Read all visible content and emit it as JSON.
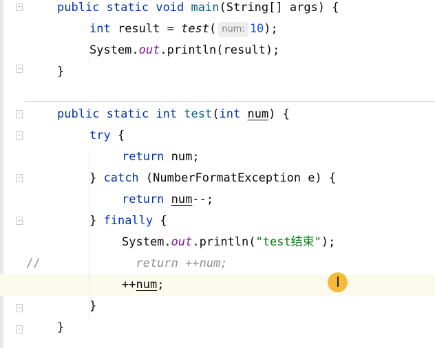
{
  "editor": {
    "lines": [
      {
        "indent": 0,
        "tokens": [
          [
            "kw",
            "public"
          ],
          [
            "t",
            " "
          ],
          [
            "kw",
            "static"
          ],
          [
            "t",
            " "
          ],
          [
            "kw",
            "void"
          ],
          [
            "t",
            " "
          ],
          [
            "fn",
            "main"
          ],
          [
            "t",
            "(String[] args) {"
          ]
        ]
      },
      {
        "indent": 1,
        "tokens": [
          [
            "kw",
            "int"
          ],
          [
            "t",
            " result = "
          ],
          [
            "ic",
            "test"
          ],
          [
            "t",
            "("
          ],
          [
            "hint",
            "num:"
          ],
          [
            "num",
            "10"
          ],
          [
            "t",
            ");"
          ]
        ]
      },
      {
        "indent": 1,
        "tokens": [
          [
            "t",
            "System."
          ],
          [
            "f",
            "out"
          ],
          [
            "t",
            ".println(result);"
          ]
        ]
      },
      {
        "indent": 0,
        "tokens": [
          [
            "t",
            "}"
          ]
        ]
      },
      {
        "indent": 0,
        "tokens": []
      },
      {
        "indent": 0,
        "tokens": [
          [
            "kw",
            "public"
          ],
          [
            "t",
            " "
          ],
          [
            "kw",
            "static"
          ],
          [
            "t",
            " "
          ],
          [
            "kw",
            "int"
          ],
          [
            "t",
            " "
          ],
          [
            "fn",
            "test"
          ],
          [
            "t",
            "("
          ],
          [
            "kw",
            "int"
          ],
          [
            "t",
            " "
          ],
          [
            "u",
            "num"
          ],
          [
            "t",
            ") {"
          ]
        ]
      },
      {
        "indent": 1,
        "tokens": [
          [
            "kw",
            "try"
          ],
          [
            "t",
            " {"
          ]
        ]
      },
      {
        "indent": 2,
        "tokens": [
          [
            "kw",
            "return"
          ],
          [
            "t",
            " num;"
          ]
        ]
      },
      {
        "indent": 1,
        "tokens": [
          [
            "t",
            "} "
          ],
          [
            "kw",
            "catch"
          ],
          [
            "t",
            " (NumberFormatException e) {"
          ]
        ]
      },
      {
        "indent": 2,
        "tokens": [
          [
            "kw",
            "return"
          ],
          [
            "t",
            " "
          ],
          [
            "u",
            "num"
          ],
          [
            "t",
            "--;"
          ]
        ]
      },
      {
        "indent": 1,
        "tokens": [
          [
            "t",
            "} "
          ],
          [
            "kw",
            "finally"
          ],
          [
            "t",
            " {"
          ]
        ]
      },
      {
        "indent": 2,
        "tokens": [
          [
            "t",
            "System."
          ],
          [
            "f",
            "out"
          ],
          [
            "t",
            ".println("
          ],
          [
            "str",
            "\"test结束\""
          ],
          [
            "t",
            ");"
          ]
        ]
      },
      {
        "indent": 2,
        "comment_mark": "//",
        "tokens": [
          [
            "c",
            "  return ++num;"
          ]
        ]
      },
      {
        "indent": 2,
        "current": true,
        "tokens": [
          [
            "t",
            "++"
          ],
          [
            "u",
            "num"
          ],
          [
            "t",
            ";"
          ]
        ]
      },
      {
        "indent": 1,
        "tokens": [
          [
            "t",
            "}"
          ]
        ]
      },
      {
        "indent": 0,
        "tokens": [
          [
            "t",
            "}"
          ]
        ]
      }
    ]
  },
  "colors": {
    "keyword": "#0033b3",
    "method_declaration": "#00627a",
    "number": "#1750eb",
    "string": "#067d17",
    "static_field": "#871094",
    "comment": "#8c8c8c",
    "current_line": "#fcfaed",
    "mouse_highlight": "#f5b631"
  },
  "icons": {
    "mouse_cursor": "text-ibeam-icon"
  }
}
